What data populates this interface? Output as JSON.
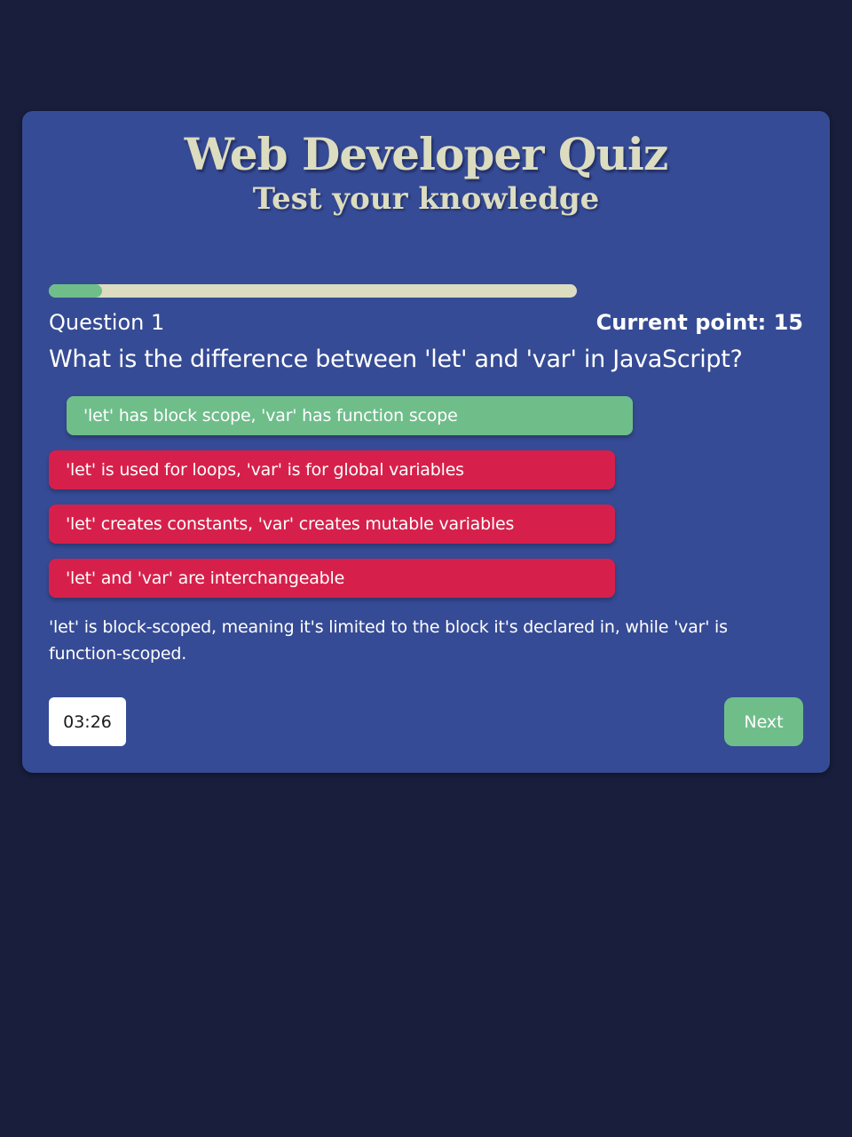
{
  "header": {
    "title": "Web Developer Quiz",
    "subtitle": "Test your knowledge"
  },
  "progress": {
    "fraction": 0.1
  },
  "question": {
    "number_label": "Question 1",
    "points_label": "Current point: 15",
    "text": "What is the difference between 'let' and 'var' in JavaScript?"
  },
  "answers": [
    {
      "label": "'let' has block scope, 'var' has function scope",
      "state": "correct"
    },
    {
      "label": "'let' is used for loops, 'var' is for global variables",
      "state": "wrong"
    },
    {
      "label": "'let' creates constants, 'var' creates mutable variables",
      "state": "wrong"
    },
    {
      "label": "'let' and 'var' are interchangeable",
      "state": "wrong"
    }
  ],
  "explanation": "'let' is block-scoped, meaning it's limited to the block it's declared in, while 'var' is function-scoped.",
  "footer": {
    "timer": "03:26",
    "next_label": "Next"
  },
  "colors": {
    "background": "#181e3b",
    "card": "#364b95",
    "accent_green": "#6fbe8a",
    "wrong_red": "#d6204b",
    "title_cream": "#dcdcc0"
  }
}
